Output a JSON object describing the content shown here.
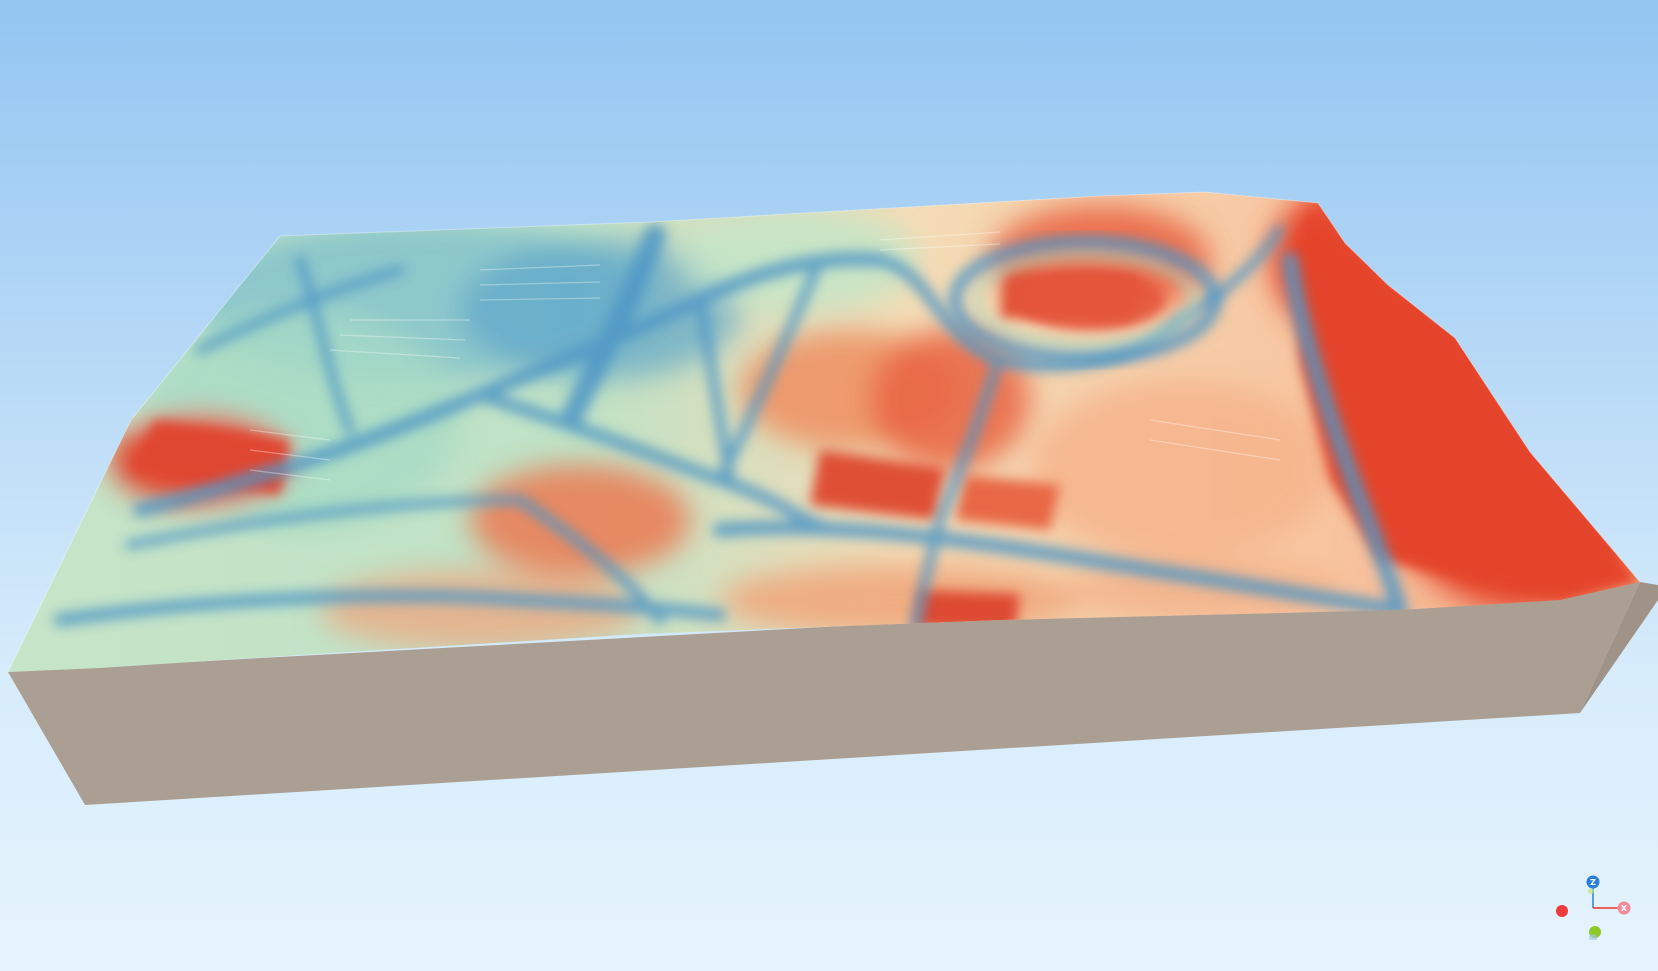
{
  "viewer": {
    "background_top": "#93c5f1",
    "background_bottom": "#e6f4fd"
  },
  "terrain": {
    "colormap": [
      "#4f97c6",
      "#9fd5c3",
      "#f2f0c4",
      "#f4a377",
      "#e44a2f"
    ],
    "base_color": "#ab9f94"
  },
  "axis_gizmo": {
    "z_label": "Z",
    "x_label": "X",
    "x_color": "#f48a9a",
    "y_color": "#8ccc28",
    "z_color": "#2b7fdc",
    "neg_x_color": "#ee3b3b"
  }
}
